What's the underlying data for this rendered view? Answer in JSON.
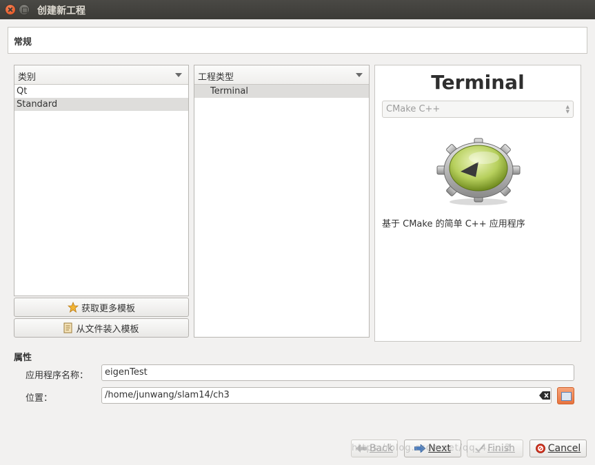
{
  "window": {
    "title": "创建新工程"
  },
  "header": {
    "label": "常规"
  },
  "category_panel": {
    "title": "类别",
    "items": [
      {
        "label": "Qt",
        "selected": false
      },
      {
        "label": "Standard",
        "selected": true
      }
    ]
  },
  "type_panel": {
    "title": "工程类型",
    "items": [
      {
        "label": "Terminal",
        "selected": true
      }
    ]
  },
  "side_buttons": {
    "get_more": "获取更多模板",
    "load_from_file": "从文件装入模板"
  },
  "preview": {
    "title": "Terminal",
    "combo_value": "CMake C++",
    "description": "基于 CMake 的简单 C++ 应用程序"
  },
  "properties": {
    "title": "属性",
    "app_name_label": "应用程序名称：",
    "app_name_value": "eigenTest",
    "location_label": "位置：",
    "location_value": "/home/junwang/slam14/ch3"
  },
  "buttons": {
    "back_label": "Back",
    "next_label": "Next",
    "finish_label": "Finish",
    "cancel_label": "Cancel"
  },
  "watermark": "https://blog.csdn.net/qq_4.....2"
}
